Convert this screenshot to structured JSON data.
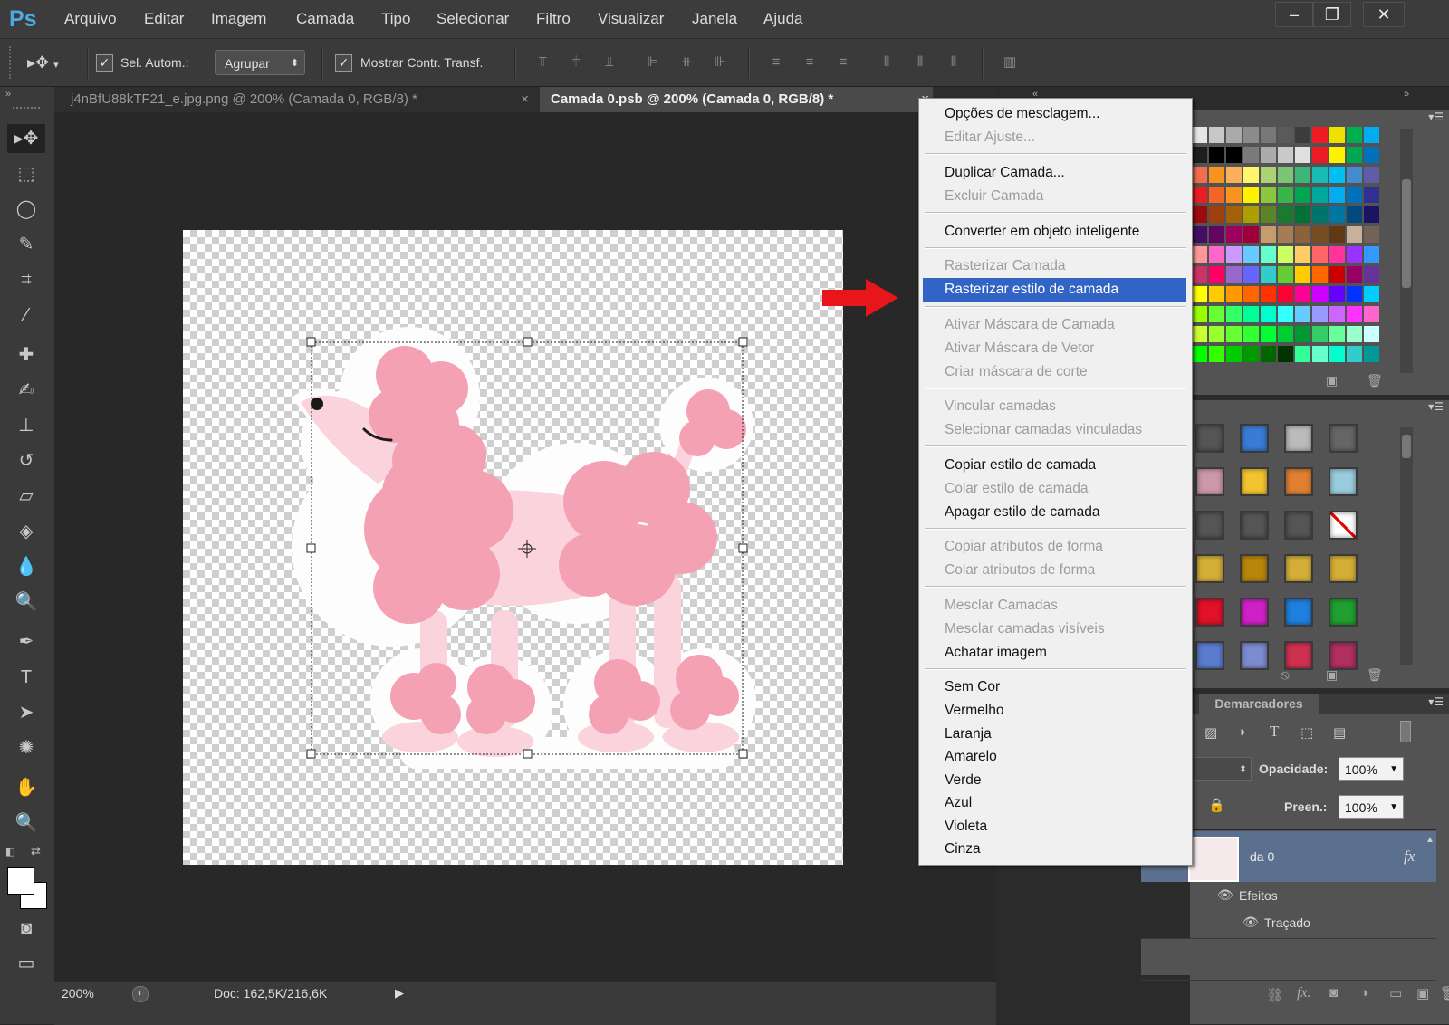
{
  "app": {
    "logo": "Ps",
    "menus": [
      "Arquivo",
      "Editar",
      "Imagem",
      "Camada",
      "Tipo",
      "Selecionar",
      "Filtro",
      "Visualizar",
      "Janela",
      "Ajuda"
    ],
    "window_controls": {
      "minimize": "‒",
      "restore": "❐",
      "close": "✕"
    }
  },
  "options_bar": {
    "auto_select_label": "Sel. Autom.:",
    "auto_select_checked": true,
    "group_select_value": "Agrupar",
    "show_transform_label": "Mostrar Contr. Transf.",
    "show_transform_checked": true
  },
  "tabs": [
    {
      "label": "j4nBfU88kTF21_e.jpg.png @ 200% (Camada 0, RGB/8) *",
      "active": false,
      "close": "×"
    },
    {
      "label": "Camada 0.psb @ 200% (Camada 0, RGB/8) *",
      "active": true,
      "close": "×"
    }
  ],
  "context_menu": {
    "items": [
      {
        "label": "Opções de mesclagem...",
        "enabled": true
      },
      {
        "label": "Editar Ajuste...",
        "enabled": false
      },
      {
        "label": "Duplicar Camada...",
        "enabled": true
      },
      {
        "label": "Excluir Camada",
        "enabled": false
      },
      {
        "label": "Converter em objeto inteligente",
        "enabled": true
      },
      {
        "label": "Rasterizar Camada",
        "enabled": false
      },
      {
        "label": "Rasterizar estilo de camada",
        "enabled": true,
        "highlighted": true
      },
      {
        "label": "Ativar Máscara de Camada",
        "enabled": false
      },
      {
        "label": "Ativar Máscara de Vetor",
        "enabled": false
      },
      {
        "label": "Criar máscara de corte",
        "enabled": false
      },
      {
        "label": "Vincular camadas",
        "enabled": false
      },
      {
        "label": "Selecionar camadas vinculadas",
        "enabled": false
      },
      {
        "label": "Copiar estilo de camada",
        "enabled": true
      },
      {
        "label": "Colar estilo de camada",
        "enabled": false
      },
      {
        "label": "Apagar estilo de camada",
        "enabled": true
      },
      {
        "label": "Copiar atributos de forma",
        "enabled": false
      },
      {
        "label": "Colar atributos de forma",
        "enabled": false
      },
      {
        "label": "Mesclar Camadas",
        "enabled": false
      },
      {
        "label": "Mesclar camadas visíveis",
        "enabled": false
      },
      {
        "label": "Achatar imagem",
        "enabled": true
      },
      {
        "label": "Sem Cor",
        "enabled": true
      },
      {
        "label": "Vermelho",
        "enabled": true
      },
      {
        "label": "Laranja",
        "enabled": true
      },
      {
        "label": "Amarelo",
        "enabled": true
      },
      {
        "label": "Verde",
        "enabled": true
      },
      {
        "label": "Azul",
        "enabled": true
      },
      {
        "label": "Violeta",
        "enabled": true
      },
      {
        "label": "Cinza",
        "enabled": true
      }
    ]
  },
  "panels": {
    "markers_tab": "Demarcadores",
    "opacity_label": "Opacidade:",
    "opacity_value": "100%",
    "fill_label": "Preen.:",
    "fill_value": "100%",
    "layer_name_partial": "da 0",
    "fx_badge": "fx",
    "effects_label": "Efeitos",
    "stroke_label": "Traçado"
  },
  "status": {
    "zoom": "200%",
    "doc_info": "Doc: 162,5K/216,6K"
  },
  "colors": {
    "accent_highlight": "#3164c4",
    "arrow_red": "#e8151b",
    "poodle_pink": "#f4a1b3",
    "poodle_light": "#fad3dc"
  }
}
